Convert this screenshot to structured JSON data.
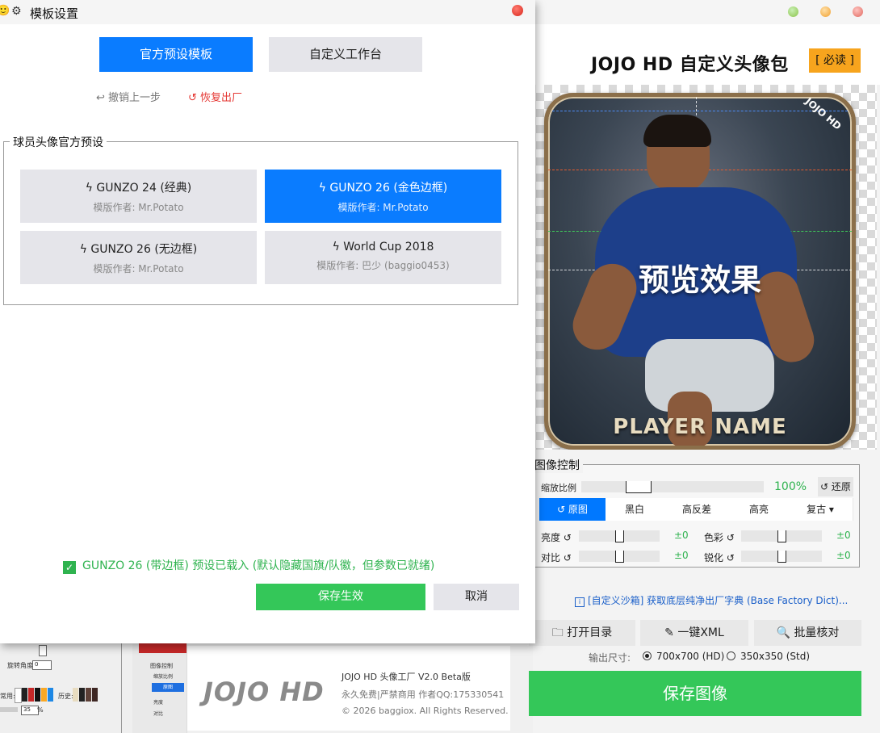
{
  "dialog": {
    "title": "模板设置",
    "tabs": [
      {
        "label": "官方预设模板",
        "active": true
      },
      {
        "label": "自定义工作台",
        "active": false
      }
    ],
    "undo_label": "撤销上一步",
    "restore_label": "恢复出厂",
    "group_title": "球员头像官方预设",
    "presets": [
      {
        "name": "GUNZO 24 (经典)",
        "author": "模版作者: Mr.Potato",
        "active": false
      },
      {
        "name": "GUNZO 26 (金色边框)",
        "author": "模版作者: Mr.Potato",
        "active": true
      },
      {
        "name": "GUNZO 26 (无边框)",
        "author": "模版作者: Mr.Potato",
        "active": false
      },
      {
        "name": "World Cup 2018",
        "author": "模版作者: 巴少 (baggio0453)",
        "active": false
      }
    ],
    "status_text": "GUNZO 26 (带边框) 预设已载入 (默认隐藏国旗/队徽，但参数已就绪)",
    "save_label": "保存生效",
    "cancel_label": "取消"
  },
  "main": {
    "title": "JOJO HD 自定义头像包",
    "must_read": "[ 必读 ]",
    "preview_label": "预览效果",
    "player_name": "PLAYER NAME",
    "card_brand": "JOJO HD",
    "image_control": {
      "title": "图像控制",
      "zoom_label": "缩放比例",
      "zoom_value": "100%",
      "zoom_level": 0.28,
      "reset_label": "↺ 还原",
      "filters": [
        {
          "label": "↺ 原图",
          "active": true
        },
        {
          "label": "黑白",
          "active": false
        },
        {
          "label": "高反差",
          "active": false
        },
        {
          "label": "高亮",
          "active": false
        },
        {
          "label": "复古 ▾",
          "active": false
        }
      ],
      "adjustments": [
        {
          "label": "亮度",
          "value": "±0"
        },
        {
          "label": "色彩",
          "value": "±0"
        },
        {
          "label": "对比",
          "value": "±0"
        },
        {
          "label": "锐化",
          "value": "±0"
        }
      ]
    },
    "sandbox_link": "[自定义沙箱] 获取底层纯净出厂字典 (Base Factory Dict)...",
    "tools": [
      {
        "label": "打开目录",
        "icon": "folder-icon"
      },
      {
        "label": "一键XML",
        "icon": "edit-icon"
      },
      {
        "label": "批量核对",
        "icon": "search-icon"
      }
    ],
    "output_size_label": "输出尺寸:",
    "output_options": [
      {
        "label": "700x700 (HD)",
        "selected": true
      },
      {
        "label": "350x350 (Std)",
        "selected": false
      }
    ],
    "save_image_label": "保存图像"
  },
  "footer": {
    "logo": "JOJO HD",
    "product": "JOJO HD 头像工厂 V2.0 Beta版",
    "license": "永久免费|严禁商用 作者QQ:175330541",
    "copyright": "© 2026 baggiox. All Rights Reserved."
  },
  "background_window": {
    "rotate_label": "旋转角度:",
    "rotate_value": "0",
    "history_label": "历史:",
    "common_label": "常用:",
    "percent_value": "35",
    "percent_unit": "%",
    "mini_panel_title": "图像控制",
    "mini_zoom_label": "缩放比例",
    "mini_original_label": "原图",
    "mini_brightness_label": "亮度",
    "mini_contrast_label": "对比"
  },
  "colors": {
    "accent_blue": "#0a7cff",
    "success_green": "#34c759",
    "warning_orange": "#f7a41d",
    "restore_red": "#e53935"
  }
}
